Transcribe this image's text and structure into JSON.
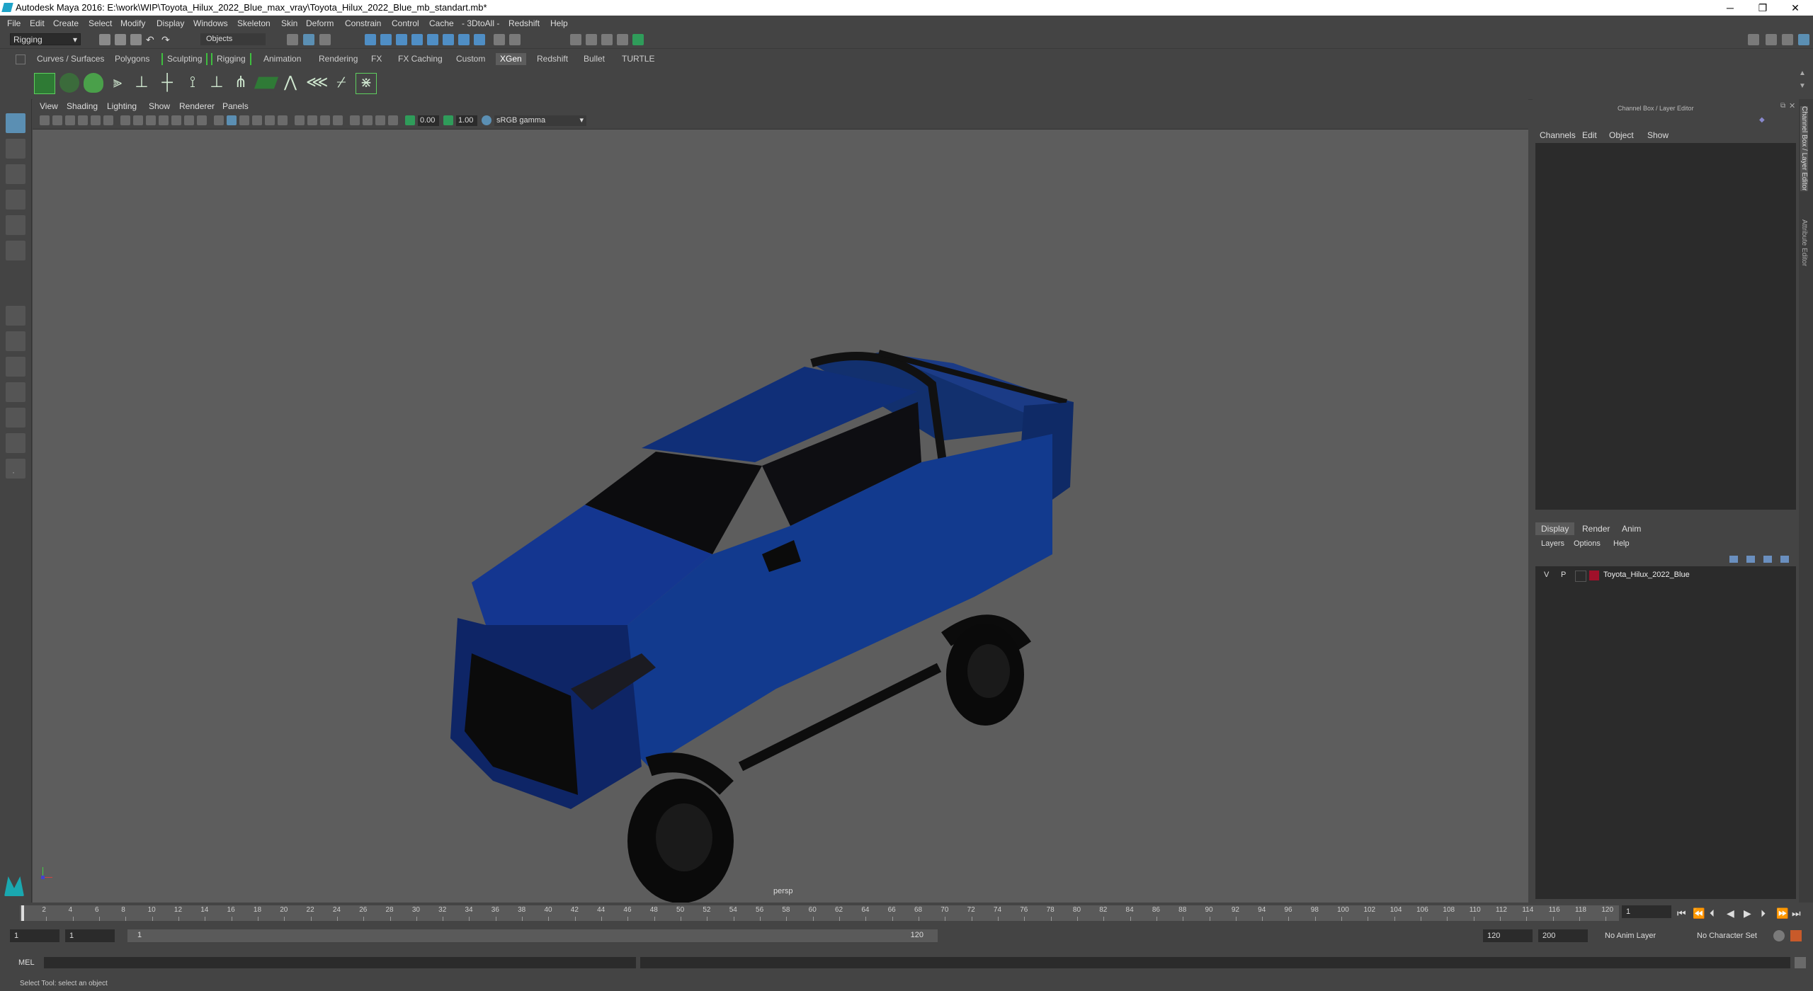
{
  "window": {
    "title": "Autodesk Maya 2016: E:\\work\\WIP\\Toyota_Hilux_2022_Blue_max_vray\\Toyota_Hilux_2022_Blue_mb_standart.mb*",
    "minimize": "─",
    "restore": "❐",
    "close": "✕"
  },
  "menubar": [
    "File",
    "Edit",
    "Create",
    "Select",
    "Modify",
    "Display",
    "Windows",
    "Skeleton",
    "Skin",
    "Deform",
    "Constrain",
    "Control",
    "Cache",
    "- 3DtoAll -",
    "Redshift",
    "Help"
  ],
  "statusline": {
    "mode": "Rigging",
    "selection_mode": "Objects"
  },
  "shelf": {
    "tabs": [
      "Curves / Surfaces",
      "Polygons",
      "Sculpting",
      "Rigging",
      "Animation",
      "Rendering",
      "FX",
      "FX Caching",
      "Custom",
      "XGen",
      "Redshift",
      "Bullet",
      "TURTLE"
    ],
    "active_tab": "XGen"
  },
  "viewport": {
    "menus": [
      "View",
      "Shading",
      "Lighting",
      "Show",
      "Renderer",
      "Panels"
    ],
    "exposure": "0.00",
    "gamma": "1.00",
    "color_space": "sRGB gamma",
    "camera_label": "persp"
  },
  "channel_box": {
    "title": "Channel Box / Layer Editor",
    "menus": [
      "Channels",
      "Edit",
      "Object",
      "Show"
    ]
  },
  "layer_editor": {
    "tabs": [
      "Display",
      "Render",
      "Anim"
    ],
    "active_tab": "Display",
    "menus": [
      "Layers",
      "Options",
      "Help"
    ],
    "layers": [
      {
        "v": "V",
        "p": "P",
        "name": "Toyota_Hilux_2022_Blue",
        "color": "#a0102a"
      }
    ]
  },
  "side_strip": {
    "tab1": "Channel Box / Layer Editor",
    "tab2": "Attribute Editor"
  },
  "timeline": {
    "ticks": [
      "2",
      "4",
      "6",
      "8",
      "10",
      "12",
      "14",
      "16",
      "18",
      "20",
      "22",
      "24",
      "26",
      "28",
      "30",
      "32",
      "34",
      "36",
      "38",
      "40",
      "42",
      "44",
      "46",
      "48",
      "50",
      "52",
      "54",
      "56",
      "58",
      "60",
      "62",
      "64",
      "66",
      "68",
      "70",
      "72",
      "74",
      "76",
      "78",
      "80",
      "82",
      "84",
      "86",
      "88",
      "90",
      "92",
      "94",
      "96",
      "98",
      "100",
      "102",
      "104",
      "106",
      "108",
      "110",
      "112",
      "114",
      "116",
      "118",
      "120"
    ],
    "current_frame": "1"
  },
  "range": {
    "start": "1",
    "playback_start": "1",
    "slider_start": "1",
    "slider_end": "120",
    "playback_end": "120",
    "end": "200",
    "anim_layer": "No Anim Layer",
    "character_set": "No Character Set"
  },
  "command_line": {
    "label": "MEL"
  },
  "help_line": {
    "text": "Select Tool: select an object"
  }
}
